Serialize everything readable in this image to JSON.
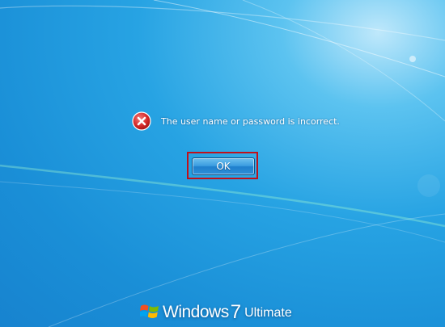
{
  "dialog": {
    "message": "The user name or password is incorrect.",
    "icon": "error-icon",
    "ok_label": "OK"
  },
  "branding": {
    "product": "Windows",
    "version": "7",
    "edition": "Ultimate",
    "icon": "windows-logo-icon"
  },
  "colors": {
    "background": "#1a8fd7",
    "focus_outline": "#c0101a",
    "error_red": "#d42a2a"
  }
}
